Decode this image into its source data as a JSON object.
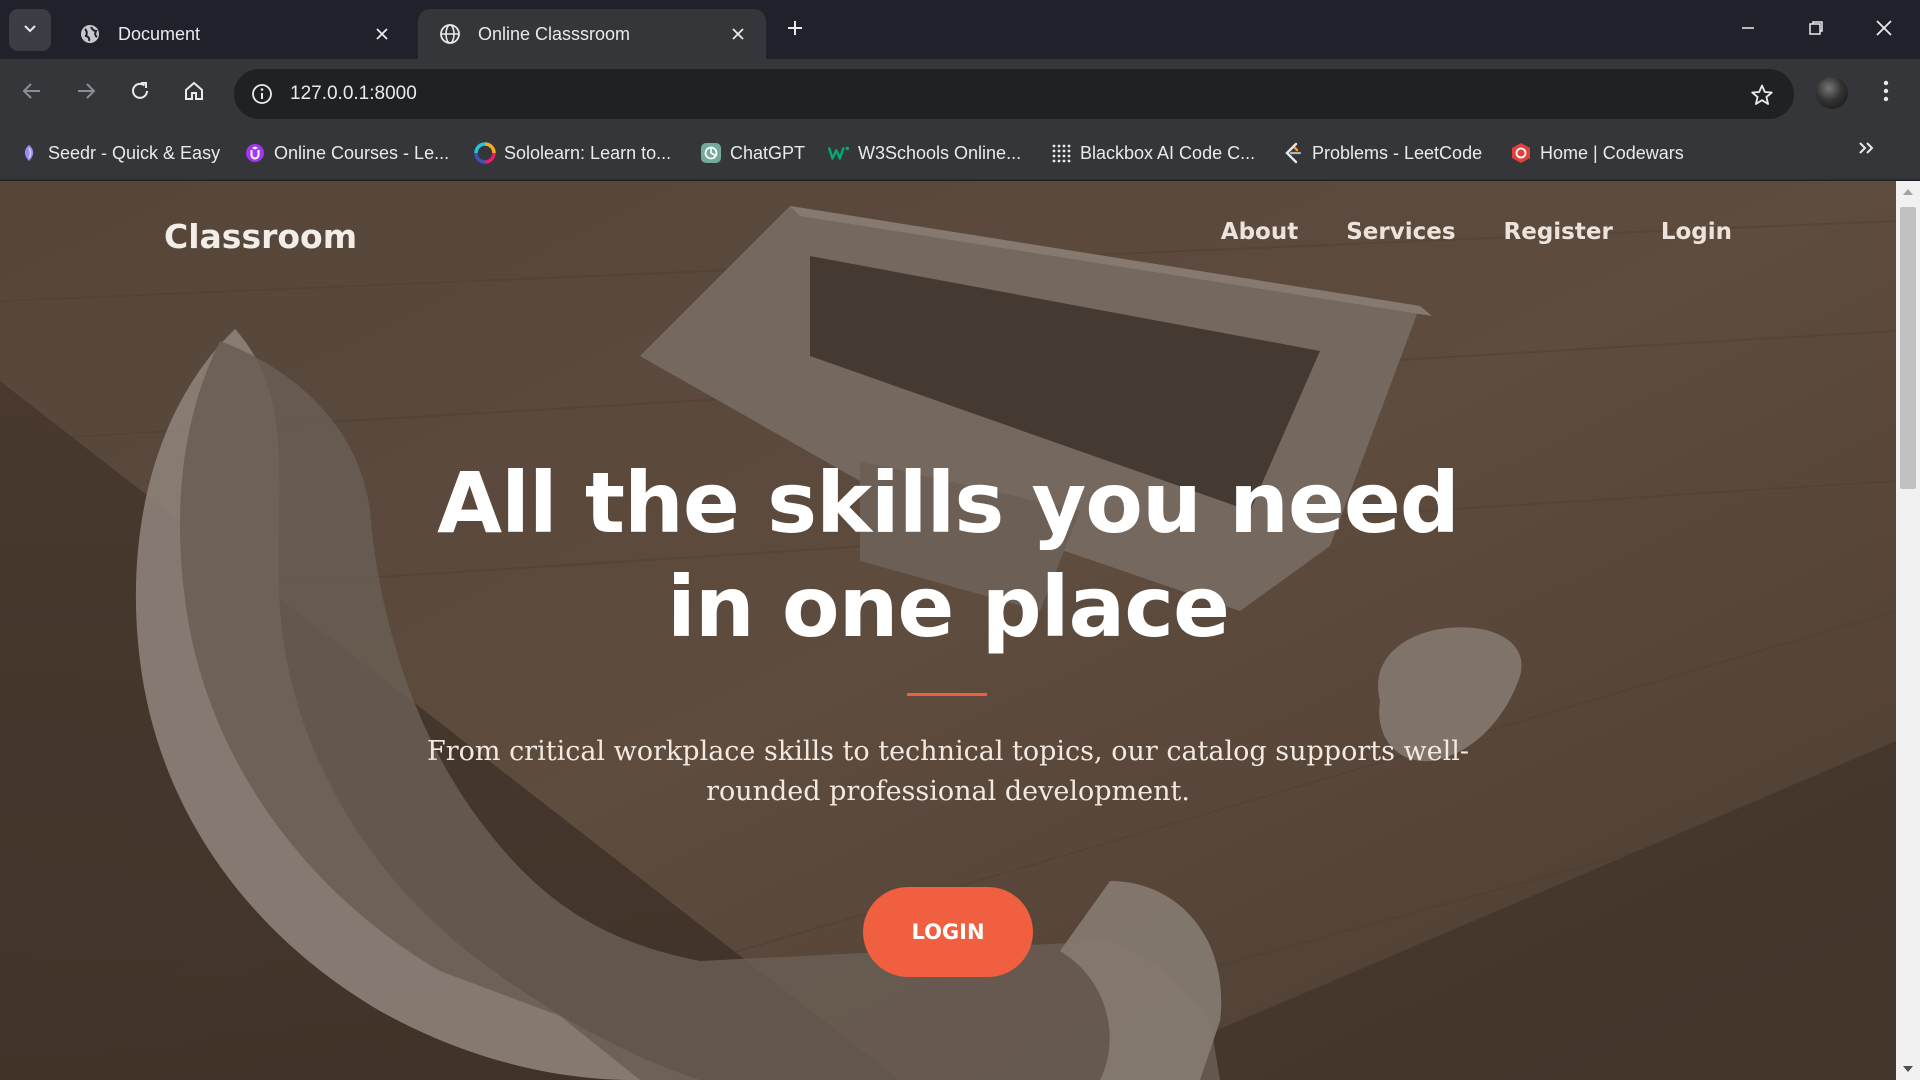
{
  "browser": {
    "tabs": [
      {
        "title": "Document",
        "favicon": "globe-icon",
        "active": false
      },
      {
        "title": "Online Classsroom",
        "favicon": "globe-icon",
        "active": true
      }
    ],
    "url": "127.0.0.1:8000",
    "bookmarks": [
      {
        "label": "Seedr - Quick & Easy",
        "icon": "seedr-icon"
      },
      {
        "label": "Online Courses - Le...",
        "icon": "udemy-icon"
      },
      {
        "label": "Sololearn: Learn to...",
        "icon": "sololearn-icon"
      },
      {
        "label": "ChatGPT",
        "icon": "chatgpt-icon"
      },
      {
        "label": "W3Schools Online...",
        "icon": "w3schools-icon"
      },
      {
        "label": "Blackbox AI Code C...",
        "icon": "blackbox-icon"
      },
      {
        "label": "Problems - LeetCode",
        "icon": "leetcode-icon"
      },
      {
        "label": "Home | Codewars",
        "icon": "codewars-icon"
      }
    ]
  },
  "page": {
    "brand": "Classroom",
    "nav": [
      "About",
      "Services",
      "Register",
      "Login"
    ],
    "hero": {
      "title": "All the skills you need in one place",
      "subtitle": "From critical workplace skills to technical topics, our catalog supports well-rounded professional development.",
      "cta": "LOGIN"
    }
  },
  "colors": {
    "accent": "#f05f40",
    "chrome_dark": "#1f222a",
    "chrome_toolbar": "#35363a",
    "hero_overlay": "#3c2c21"
  }
}
